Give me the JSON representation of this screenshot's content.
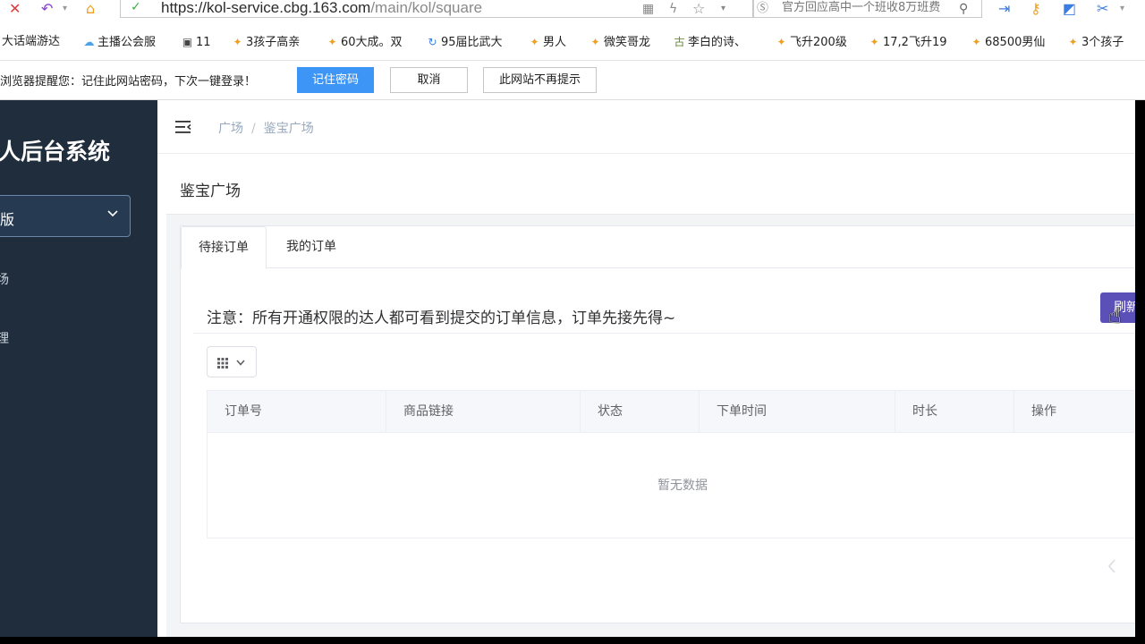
{
  "browser": {
    "url_host": "https://kol-service.cbg.163.com",
    "url_path": "/main/kol/square",
    "search_text": "官方回应高中一个班收8万班费"
  },
  "bookmarks": [
    {
      "label": "大话端游达",
      "icon": "page-icon"
    },
    {
      "label": "主播公会服",
      "icon": "cloud-icon"
    },
    {
      "label": "11",
      "icon": "game-icon"
    },
    {
      "label": "3孩子高亲",
      "icon": "star-icon"
    },
    {
      "label": "60大成。双",
      "icon": "star-icon"
    },
    {
      "label": "95届比武大",
      "icon": "refresh-icon"
    },
    {
      "label": "男人",
      "icon": "star-icon"
    },
    {
      "label": "微笑哥龙",
      "icon": "star-icon"
    },
    {
      "label": "李白的诗、",
      "icon": "ancient-icon"
    },
    {
      "label": "飞升200级",
      "icon": "star-icon"
    },
    {
      "label": "17,2飞升19",
      "icon": "star-icon"
    },
    {
      "label": "68500男仙",
      "icon": "star-icon"
    },
    {
      "label": "3个孩子",
      "icon": "star-icon"
    }
  ],
  "password_prompt": {
    "message": "浏览器提醒您：记住此网站密码，下次一键登录！",
    "save_label": "记住密码",
    "cancel_label": "取消",
    "never_label": "此网站不再提示"
  },
  "sidebar": {
    "title": "人后台系统",
    "select_label": "版",
    "items": [
      {
        "label": "场"
      },
      {
        "label": "理"
      }
    ]
  },
  "breadcrumb": {
    "root": "广场",
    "current": "鉴宝广场"
  },
  "page": {
    "heading": "鉴宝广场",
    "tabs": [
      {
        "label": "待接订单",
        "active": true
      },
      {
        "label": "我的订单",
        "active": false
      }
    ],
    "notice": "注意：所有开通权限的达人都可看到提交的订单信息，订单先接先得~",
    "refresh_label": "刷新"
  },
  "table": {
    "columns": [
      "订单号",
      "商品链接",
      "状态",
      "下单时间",
      "时长",
      "操作"
    ],
    "rows": [],
    "empty_text": "暂无数据"
  },
  "colors": {
    "sidebar_bg": "#1f2d3d",
    "primary_blue": "#3d95f5",
    "refresh_purple": "#5b50b8",
    "breadcrumb_gray": "#97a8be"
  }
}
